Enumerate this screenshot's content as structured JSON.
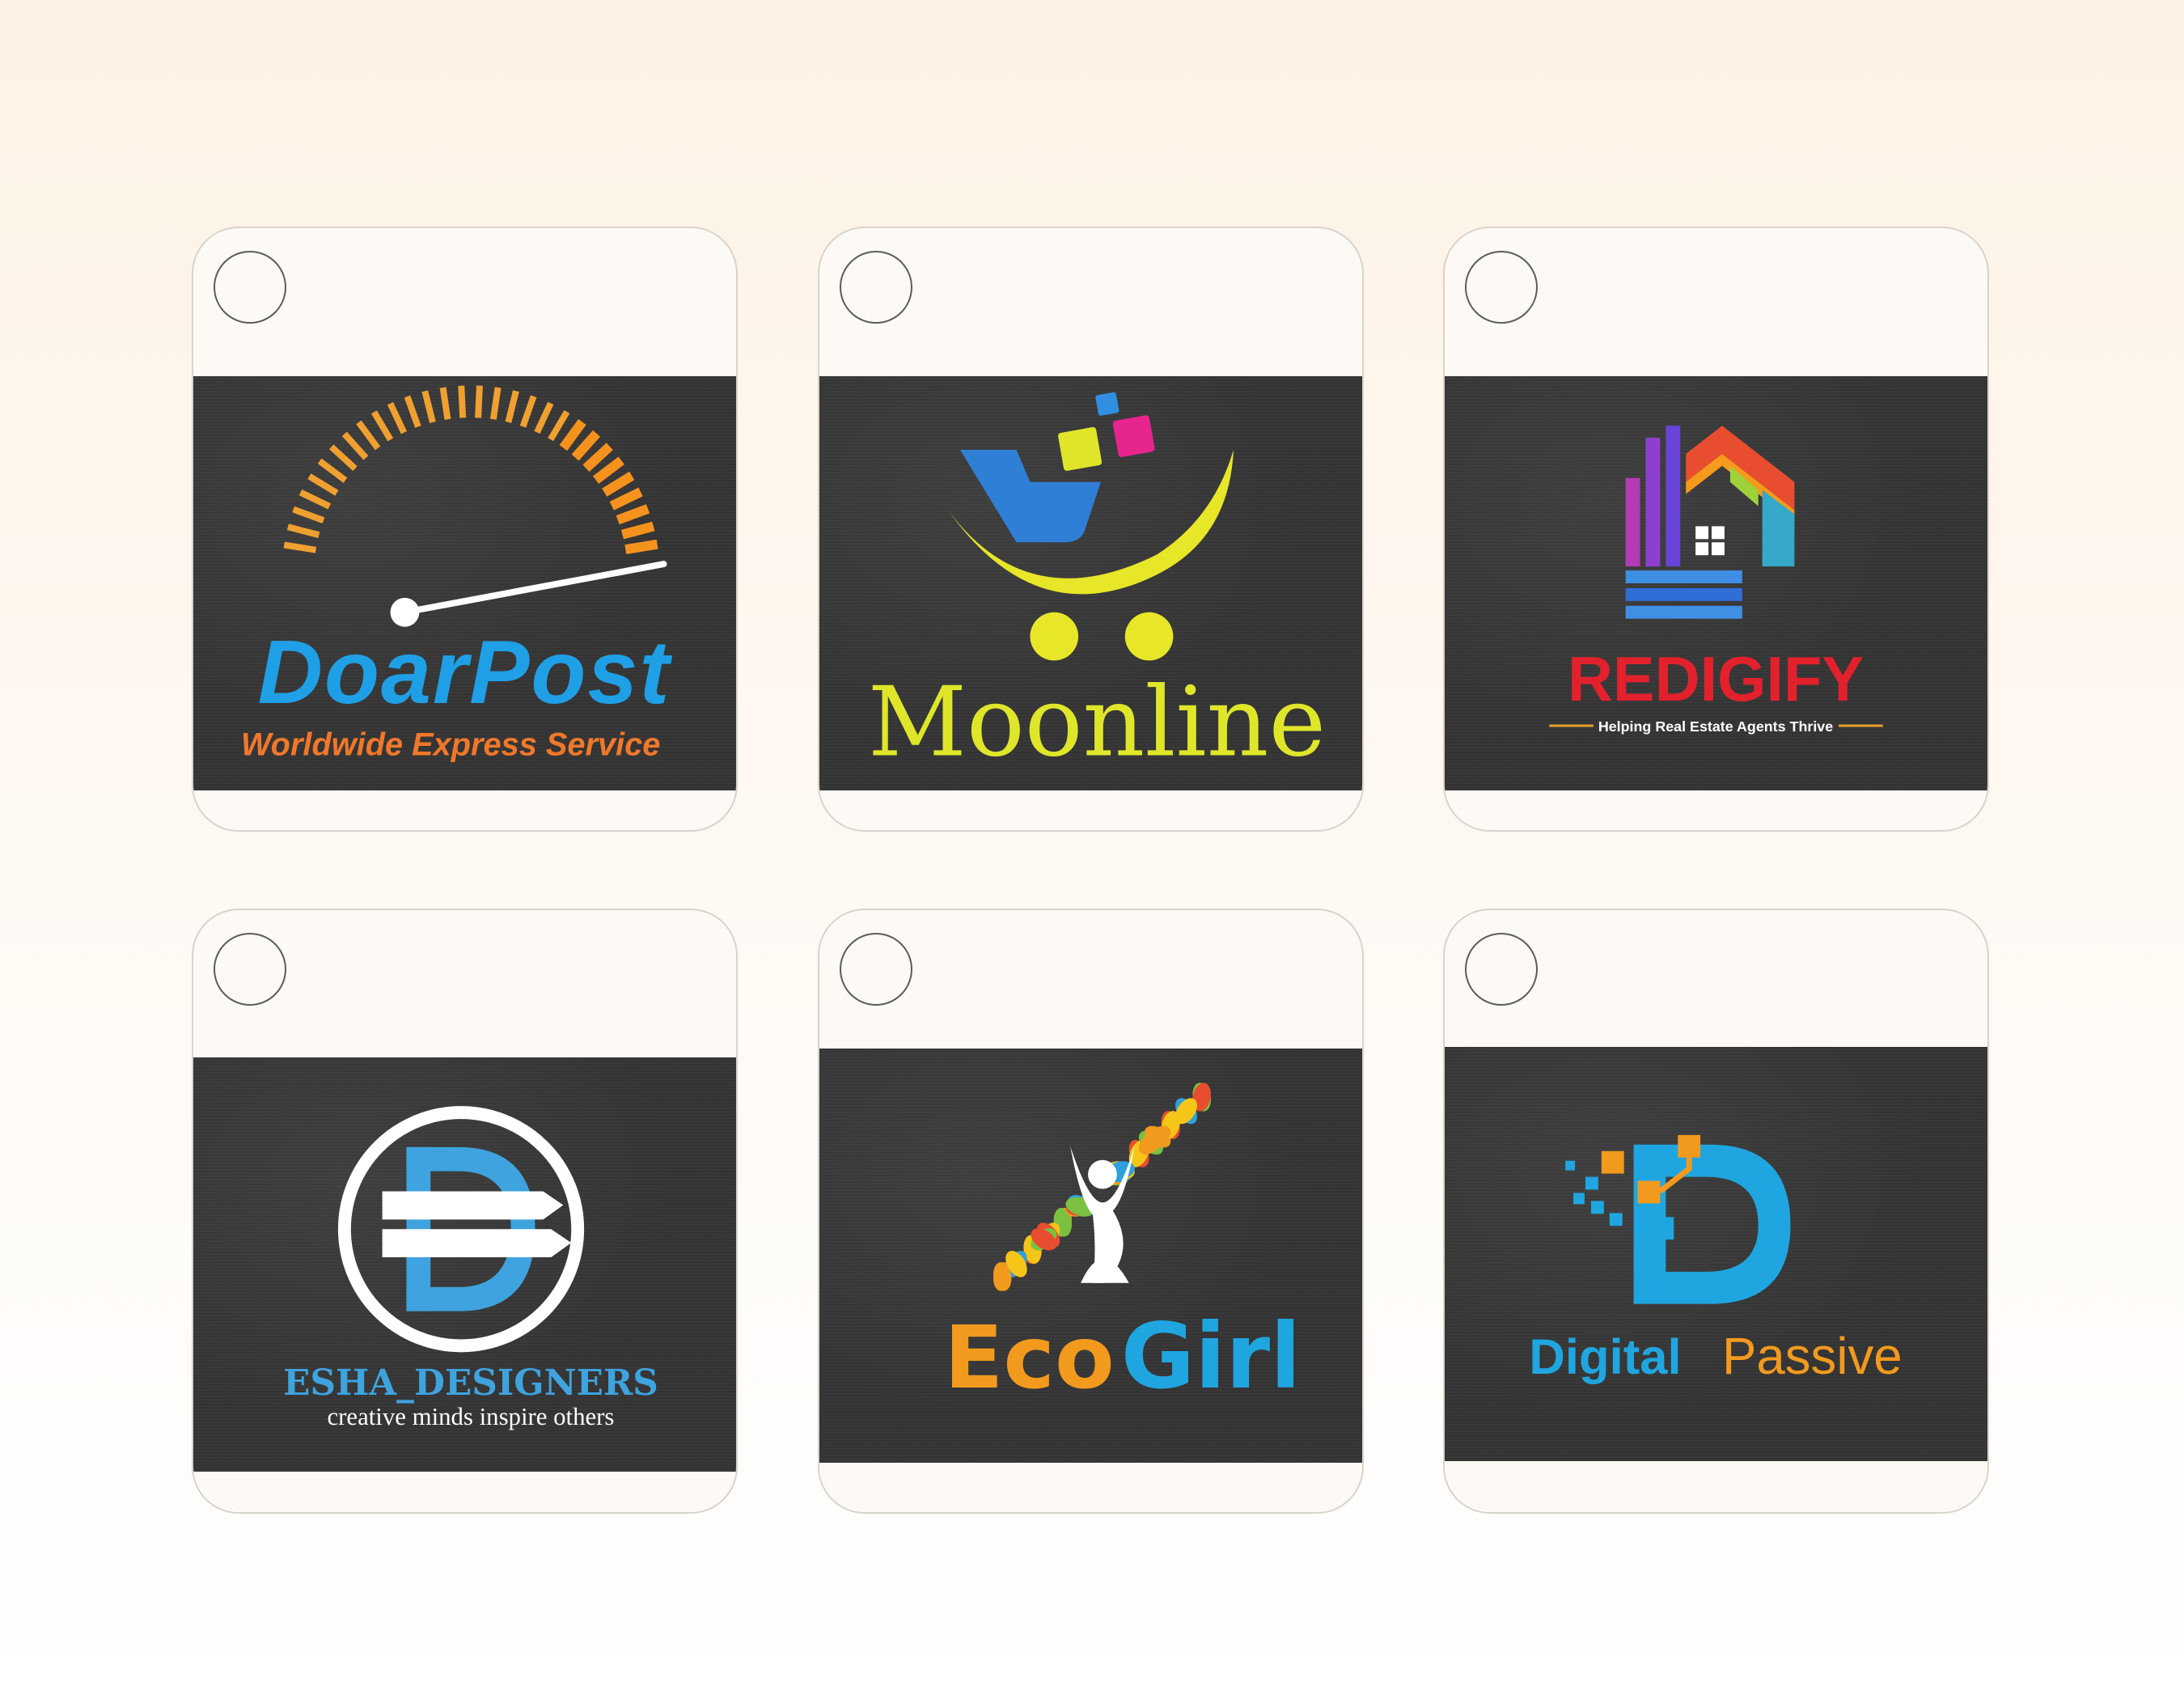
{
  "cards": [
    {
      "name": "DoarPost",
      "title": "DoarPost",
      "tagline": "Worldwide Express Service",
      "colors": {
        "title": "#1fa0e6",
        "tagline": "#f0782a",
        "arc": "#f5921e"
      },
      "icon": "speedometer-icon"
    },
    {
      "name": "Moonline",
      "title": "Moonline",
      "colors": {
        "title": "#dfe62a",
        "cart": "#2f7fd6",
        "moon": "#e7e629"
      },
      "icon": "shopping-cart-icon"
    },
    {
      "name": "REDIGIFY",
      "title": "REDIGIFY",
      "tagline": "Helping Real Estate Agents Thrive",
      "colors": {
        "title": "#e2212d",
        "tagline": "#ffffff",
        "rule": "#e5a12a"
      },
      "icon": "house-icon"
    },
    {
      "name": "ESHA_DESIGNERS",
      "title": "ESHA_DESIGNERS",
      "tagline": "creative minds inspire others",
      "colors": {
        "title": "#3ea3de",
        "tagline": "#ffffff",
        "ring": "#ffffff"
      },
      "icon": "letter-d-emblem-icon"
    },
    {
      "name": "Eco Girl",
      "title_part1": "Eco",
      "title_part2": "Girl",
      "colors": {
        "part2": "#1fa6e0"
      },
      "icon": "tree-person-icon"
    },
    {
      "name": "Digital Passive",
      "title_part1": "Digital",
      "title_part2": "Passive",
      "colors": {
        "part1": "#1fa6e0",
        "part2": "#f29a1e"
      },
      "icon": "letter-d-pixel-icon"
    }
  ]
}
